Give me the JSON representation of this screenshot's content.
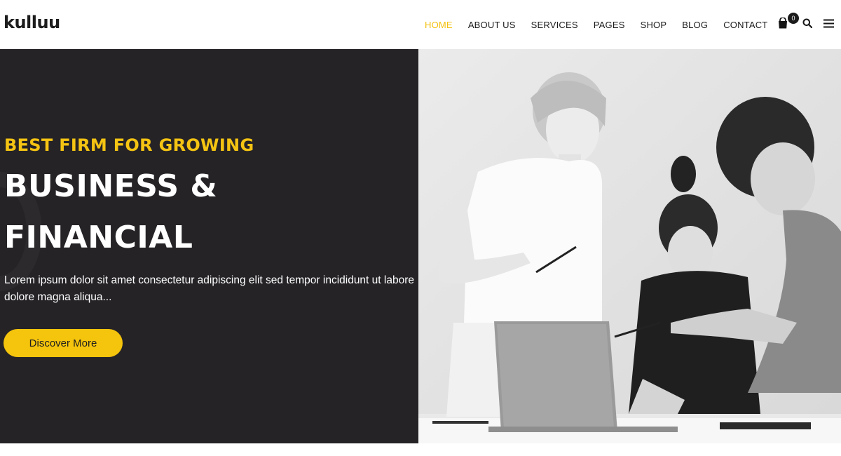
{
  "brand": {
    "logo": "kulluu"
  },
  "nav": {
    "items": [
      {
        "label": "HOME",
        "active": true
      },
      {
        "label": "ABOUT US",
        "active": false
      },
      {
        "label": "SERVICES",
        "active": false
      },
      {
        "label": "PAGES",
        "active": false
      },
      {
        "label": "SHOP",
        "active": false
      },
      {
        "label": "BLOG",
        "active": false
      },
      {
        "label": "CONTACT",
        "active": false
      }
    ],
    "cart_count": "0",
    "icons": [
      "shopping-bag-icon",
      "search-icon",
      "menu-icon"
    ]
  },
  "hero": {
    "subtitle": "BEST FIRM FOR GROWING",
    "title_line1": "BUSINESS &",
    "title_line2": "FINANCIAL",
    "description": "Lorem ipsum dolor sit amet consectetur adipiscing elit sed tempor incididunt ut labore dolore magna aliqua...",
    "button_label": "Discover More",
    "image": "black-and-white-team-meeting-photo"
  },
  "colors": {
    "accent": "#f5c40c",
    "dark_panel": "#252326",
    "text_dark": "#1a1a1a",
    "white": "#ffffff"
  }
}
